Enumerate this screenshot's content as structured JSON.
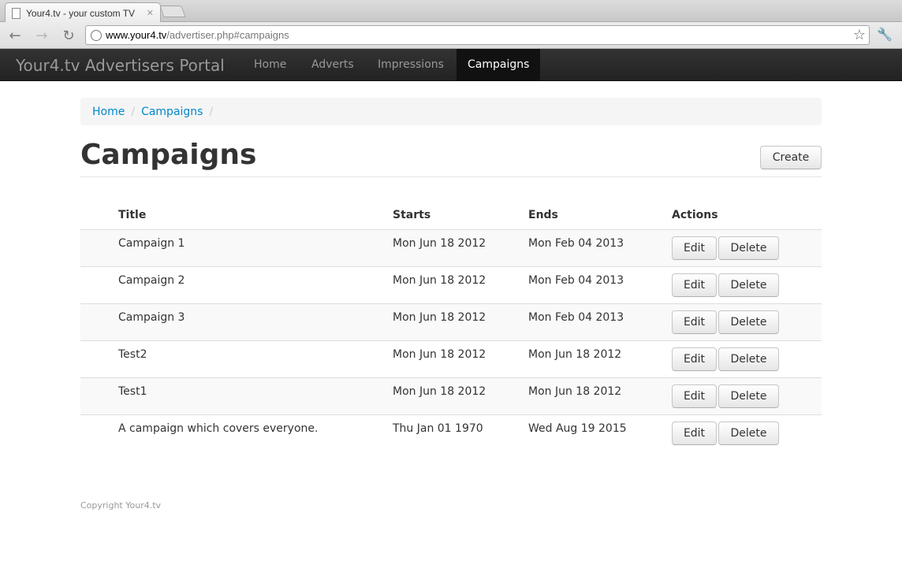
{
  "browser": {
    "tab_title": "Your4.tv - your custom TV",
    "url_host": "www.your4.tv",
    "url_path": "/advertiser.php#campaigns"
  },
  "navbar": {
    "brand": "Your4.tv Advertisers Portal",
    "items": [
      {
        "label": "Home",
        "active": false
      },
      {
        "label": "Adverts",
        "active": false
      },
      {
        "label": "Impressions",
        "active": false
      },
      {
        "label": "Campaigns",
        "active": true
      }
    ]
  },
  "breadcrumb": {
    "items": [
      "Home",
      "Campaigns"
    ],
    "separator": "/"
  },
  "page": {
    "title": "Campaigns",
    "create_label": "Create"
  },
  "table": {
    "headers": [
      "Title",
      "Starts",
      "Ends",
      "Actions"
    ],
    "edit_label": "Edit",
    "delete_label": "Delete",
    "rows": [
      {
        "title": "Campaign 1",
        "starts": "Mon Jun 18 2012",
        "ends": "Mon Feb 04 2013"
      },
      {
        "title": "Campaign 2",
        "starts": "Mon Jun 18 2012",
        "ends": "Mon Feb 04 2013"
      },
      {
        "title": "Campaign 3",
        "starts": "Mon Jun 18 2012",
        "ends": "Mon Feb 04 2013"
      },
      {
        "title": "Test2",
        "starts": "Mon Jun 18 2012",
        "ends": "Mon Jun 18 2012"
      },
      {
        "title": "Test1",
        "starts": "Mon Jun 18 2012",
        "ends": "Mon Jun 18 2012"
      },
      {
        "title": "A campaign which covers everyone.",
        "starts": "Thu Jan 01 1970",
        "ends": "Wed Aug 19 2015"
      }
    ]
  },
  "footer": {
    "text": "Copyright Your4.tv"
  },
  "colors": {
    "navbar_bg": "#222222",
    "link": "#0088cc",
    "breadcrumb_bg": "#f5f5f5"
  }
}
